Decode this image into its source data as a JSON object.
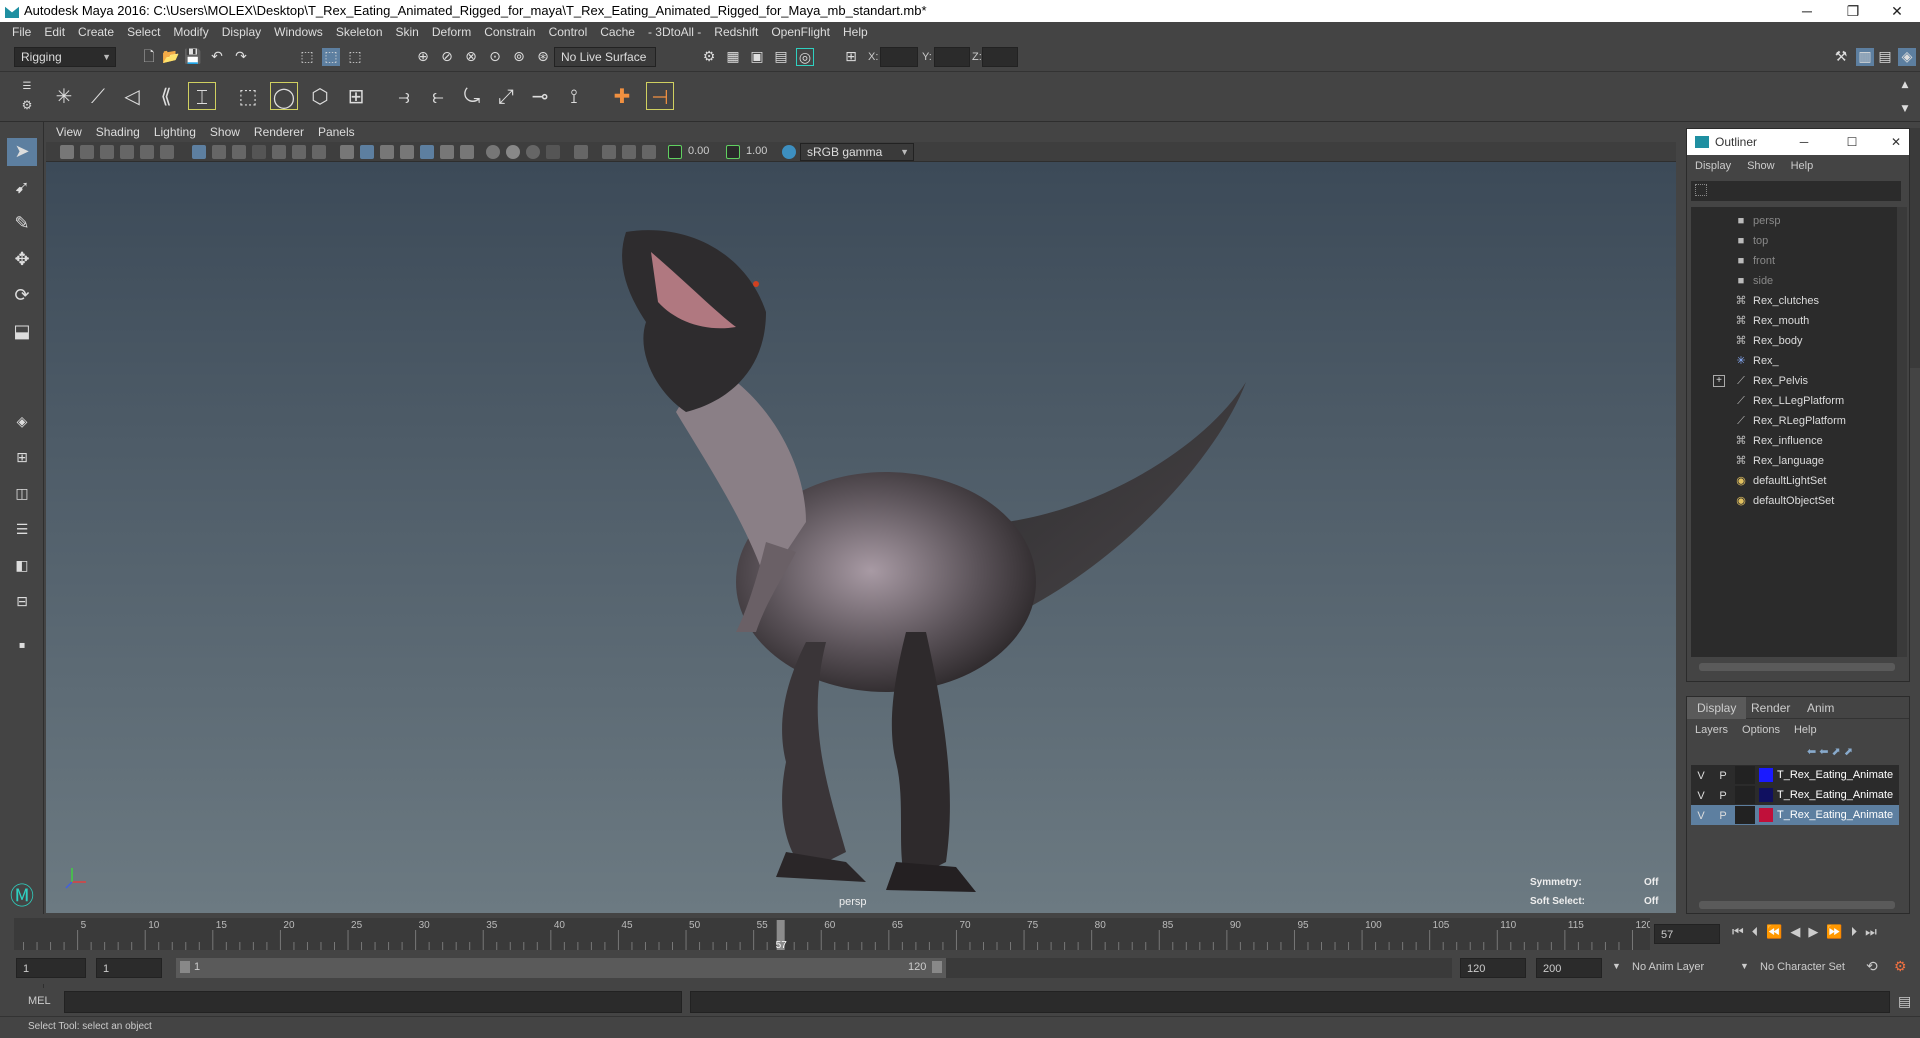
{
  "window": {
    "title": "Autodesk Maya 2016: C:\\Users\\MOLEX\\Desktop\\T_Rex_Eating_Animated_Rigged_for_maya\\T_Rex_Eating_Animated_Rigged_for_Maya_mb_standart.mb*",
    "minimize": "─",
    "restore": "❐",
    "close": "✕"
  },
  "menubar": [
    "File",
    "Edit",
    "Create",
    "Select",
    "Modify",
    "Display",
    "Windows",
    "Skeleton",
    "Skin",
    "Deform",
    "Constrain",
    "Control",
    "Cache",
    "- 3DtoAll -",
    "Redshift",
    "OpenFlight",
    "Help"
  ],
  "status": {
    "menu_set": "Rigging",
    "live_surface": "No Live Surface",
    "x_label": "X:",
    "y_label": "Y:",
    "z_label": "Z:"
  },
  "panel_menu": [
    "View",
    "Shading",
    "Lighting",
    "Show",
    "Renderer",
    "Panels"
  ],
  "panel_tools": {
    "exposure": "0.00",
    "gamma": "1.00",
    "color_space": "sRGB gamma"
  },
  "viewport": {
    "camera": "persp",
    "symmetry_label": "Symmetry:",
    "symmetry_value": "Off",
    "soft_select_label": "Soft Select:",
    "soft_select_value": "Off"
  },
  "outliner": {
    "title": "Outliner",
    "menu": [
      "Display",
      "Show",
      "Help"
    ],
    "items": [
      {
        "label": "persp",
        "icon": "camera-icon",
        "dim": true
      },
      {
        "label": "top",
        "icon": "camera-icon",
        "dim": true
      },
      {
        "label": "front",
        "icon": "camera-icon",
        "dim": true
      },
      {
        "label": "side",
        "icon": "camera-icon",
        "dim": true
      },
      {
        "label": "Rex_clutches",
        "icon": "mesh-icon",
        "dim": false
      },
      {
        "label": "Rex_mouth",
        "icon": "mesh-icon",
        "dim": false
      },
      {
        "label": "Rex_body",
        "icon": "mesh-icon",
        "dim": false
      },
      {
        "label": "Rex_",
        "icon": "locator-icon",
        "dim": false
      },
      {
        "label": "Rex_Pelvis",
        "icon": "joint-icon",
        "dim": false
      },
      {
        "label": "Rex_LLegPlatform",
        "icon": "joint-icon",
        "dim": false
      },
      {
        "label": "Rex_RLegPlatform",
        "icon": "joint-icon",
        "dim": false
      },
      {
        "label": "Rex_influence",
        "icon": "mesh-icon",
        "dim": false
      },
      {
        "label": "Rex_language",
        "icon": "mesh-icon",
        "dim": false
      },
      {
        "label": "defaultLightSet",
        "icon": "set-icon",
        "dim": false
      },
      {
        "label": "defaultObjectSet",
        "icon": "set-icon",
        "dim": false
      }
    ]
  },
  "layer_editor": {
    "tabs": [
      "Display",
      "Render",
      "Anim"
    ],
    "menu": [
      "Layers",
      "Options",
      "Help"
    ],
    "layers": [
      {
        "v": "V",
        "p": "P",
        "color": "#1a1aff",
        "name": "T_Rex_Eating_Animate",
        "selected": false
      },
      {
        "v": "V",
        "p": "P",
        "color": "#101060",
        "name": "T_Rex_Eating_Animate",
        "selected": false
      },
      {
        "v": "V",
        "p": "P",
        "color": "#c0103a",
        "name": "T_Rex_Eating_Animate",
        "selected": true
      }
    ]
  },
  "timeline": {
    "ticks": [
      "5",
      "10",
      "15",
      "20",
      "25",
      "30",
      "35",
      "40",
      "45",
      "50",
      "55",
      "60",
      "65",
      "70",
      "75",
      "80",
      "85",
      "90",
      "95",
      "100",
      "105",
      "110",
      "115",
      "120"
    ],
    "current_frame": "57",
    "current_frame_field": "57"
  },
  "range": {
    "start": "1",
    "playback_start": "1",
    "slider_start": "1",
    "slider_end": "120",
    "playback_end": "120",
    "end": "200",
    "anim_layer": "No Anim Layer",
    "character_set": "No Character Set"
  },
  "command": {
    "label": "MEL"
  },
  "help": {
    "text": "Select Tool: select an object"
  }
}
